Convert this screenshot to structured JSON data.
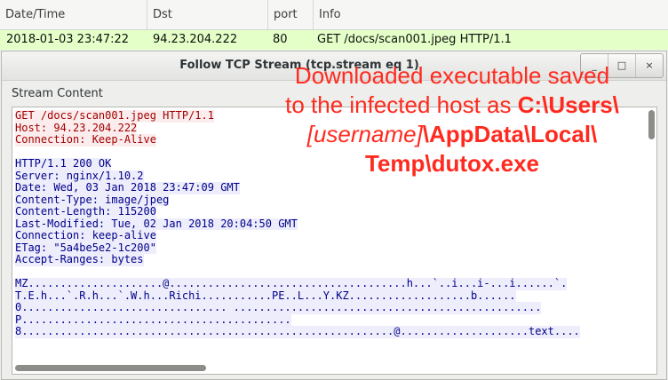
{
  "packet_list": {
    "columns": [
      "Date/Time",
      "Dst",
      "port",
      "Info"
    ],
    "row": {
      "datetime": "2018-01-03 23:47:22",
      "dst": "94.23.204.222",
      "port": "80",
      "info": "GET /docs/scan001.jpeg HTTP/1.1",
      "highlight_color": "#e4ffc7"
    }
  },
  "dialog": {
    "title": "Follow TCP Stream (tcp.stream eq 1)",
    "window_buttons": {
      "minimize": "_",
      "maximize": "□",
      "close": "×"
    },
    "section_label": "Stream Content",
    "client_color": "#a40000",
    "server_color": "#00008b",
    "client_lines": [
      "GET /docs/scan001.jpeg HTTP/1.1",
      "Host: 94.23.204.222",
      "Connection: Keep-Alive"
    ],
    "server_lines": [
      "HTTP/1.1 200 OK",
      "Server: nginx/1.10.2",
      "Date: Wed, 03 Jan 2018 23:47:09 GMT",
      "Content-Type: image/jpeg",
      "Content-Length: 115200",
      "Last-Modified: Tue, 02 Jan 2018 20:04:50 GMT",
      "Connection: keep-alive",
      "ETag: \"5a4be5e2-1c200\"",
      "Accept-Ranges: bytes"
    ],
    "binary_lines": [
      "MZ.....................@.....................................h...`..i...i-...i......`.",
      "T.E.h...`.R.h...`.W.h...Richi...........PE..L...Y.KZ...................b......",
      "0................................ ................................................",
      "P..........................................",
      "8..........................................................@....................text...."
    ]
  },
  "annotation": {
    "line1": "Downloaded executable saved",
    "line2_prefix": "to the infected host as ",
    "line2_bold": "C:\\Users\\",
    "line3_italic": "[username]",
    "line3_bold": "\\AppData\\Local\\",
    "line4_bold": "Temp\\dutox.exe",
    "color": "#ff2a1f"
  }
}
